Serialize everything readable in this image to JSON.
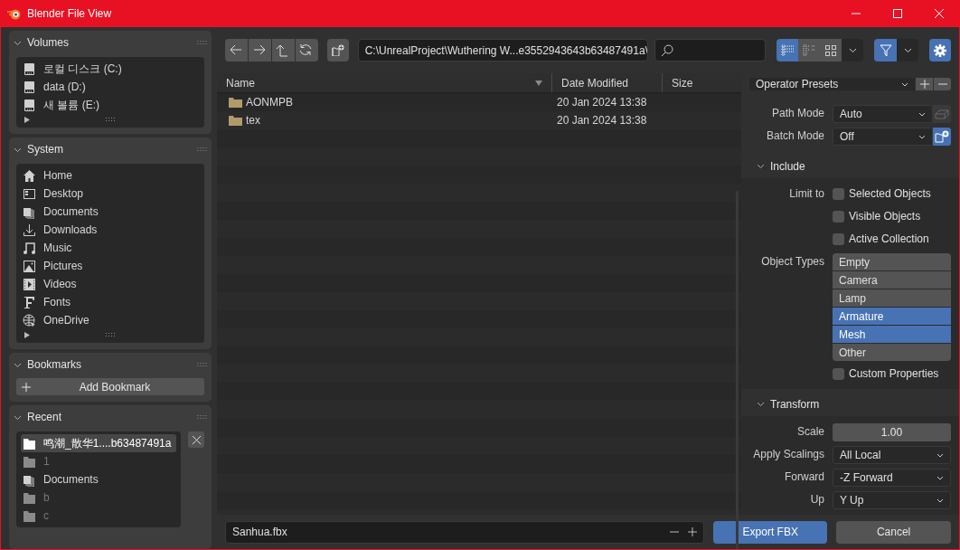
{
  "window": {
    "title": "Blender File View"
  },
  "sidebar": [
    {
      "kind": "list",
      "title": "Volumes",
      "expanded": true,
      "items": [
        {
          "label": "로컬 디스크 (C:)",
          "kind": "drive",
          "selected": false,
          "dimmed": false
        },
        {
          "label": "data (D:)",
          "kind": "drive",
          "selected": false,
          "dimmed": false
        },
        {
          "label": "새 볼륨 (E:)",
          "kind": "drive",
          "selected": false,
          "dimmed": false
        }
      ]
    },
    {
      "kind": "list",
      "title": "System",
      "expanded": true,
      "items": [
        {
          "label": "Home",
          "kind": "home",
          "selected": false,
          "dimmed": false
        },
        {
          "label": "Desktop",
          "kind": "desktop",
          "selected": false,
          "dimmed": false
        },
        {
          "label": "Documents",
          "kind": "documents",
          "selected": false,
          "dimmed": false
        },
        {
          "label": "Downloads",
          "kind": "downloads",
          "selected": false,
          "dimmed": false
        },
        {
          "label": "Music",
          "kind": "music",
          "selected": false,
          "dimmed": false
        },
        {
          "label": "Pictures",
          "kind": "pictures",
          "selected": false,
          "dimmed": false
        },
        {
          "label": "Videos",
          "kind": "videos",
          "selected": false,
          "dimmed": false
        },
        {
          "label": "Fonts",
          "kind": "fonts",
          "selected": false,
          "dimmed": false
        },
        {
          "label": "OneDrive",
          "kind": "globe",
          "selected": false,
          "dimmed": false
        }
      ]
    },
    {
      "kind": "button",
      "title": "Bookmarks",
      "expanded": true,
      "button": "Add Bookmark"
    },
    {
      "kind": "list",
      "title": "Recent",
      "expanded": true,
      "clearable": true,
      "items": [
        {
          "label": "鸣潮_散华1....b63487491a",
          "kind": "folder",
          "selected": true,
          "dimmed": false
        },
        {
          "label": "1",
          "kind": "folder",
          "selected": false,
          "dimmed": true
        },
        {
          "label": "Documents",
          "kind": "documents",
          "selected": false,
          "dimmed": false
        },
        {
          "label": "b",
          "kind": "folder",
          "selected": false,
          "dimmed": true
        },
        {
          "label": "c",
          "kind": "folder",
          "selected": false,
          "dimmed": true
        }
      ]
    }
  ],
  "toolbar": {
    "path": "C:\\UnrealProject\\Wuthering W...e3552943643b63487491a\\",
    "view_modes": [
      {
        "selected": true
      },
      {
        "selected": false
      },
      {
        "selected": false
      }
    ],
    "filter_on": true,
    "settings_on": true
  },
  "file_list": {
    "columns": [
      "Name",
      "Date Modified",
      "Size"
    ],
    "rows": [
      {
        "name": "AONMPB",
        "date": "20 Jan 2024 13:38"
      },
      {
        "name": "tex",
        "date": "20 Jan 2024 13:38"
      }
    ]
  },
  "operator": {
    "presets": "Operator Presets",
    "sections": [
      {
        "rows": [
          {
            "kind": "dropdown",
            "label": "Path Mode",
            "value": "Auto",
            "toggle_on": false
          },
          {
            "kind": "dropdown",
            "label": "Batch Mode",
            "value": "Off",
            "toggle_on": true
          }
        ]
      },
      {
        "title": "Include",
        "expanded": true,
        "rows": [
          {
            "kind": "checkbox",
            "label": "Limit to",
            "text": "Selected Objects",
            "checked": false
          },
          {
            "kind": "checkbox",
            "text": "Visible Objects",
            "checked": false
          },
          {
            "kind": "checkbox",
            "text": "Active Collection",
            "checked": false
          },
          {
            "kind": "multi",
            "label": "Object Types",
            "options": [
              {
                "text": "Empty",
                "selected": false
              },
              {
                "text": "Camera",
                "selected": false
              },
              {
                "text": "Lamp",
                "selected": false
              },
              {
                "text": "Armature",
                "selected": true
              },
              {
                "text": "Mesh",
                "selected": true
              },
              {
                "text": "Other",
                "selected": false
              }
            ]
          },
          {
            "kind": "checkbox",
            "text": "Custom Properties",
            "checked": false
          }
        ]
      },
      {
        "title": "Transform",
        "expanded": true,
        "rows": [
          {
            "kind": "number",
            "label": "Scale",
            "value": "1.00"
          },
          {
            "kind": "dropdown",
            "label": "Apply Scalings",
            "value": "All Local"
          },
          {
            "kind": "dropdown",
            "label": "Forward",
            "value": "-Z Forward"
          },
          {
            "kind": "dropdown",
            "label": "Up",
            "value": "Y Up"
          }
        ]
      }
    ]
  },
  "footer": {
    "filename": "Sanhua.fbx",
    "confirm": "Export FBX",
    "cancel": "Cancel"
  }
}
